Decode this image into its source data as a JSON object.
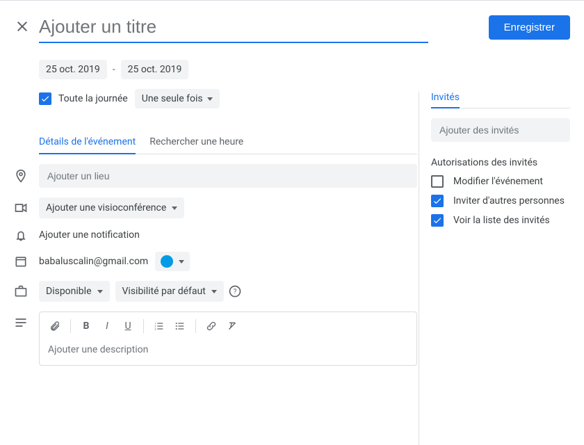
{
  "header": {
    "title_placeholder": "Ajouter un titre",
    "save_label": "Enregistrer"
  },
  "dates": {
    "start": "25 oct. 2019",
    "end": "25 oct. 2019",
    "all_day_label": "Toute la journée",
    "all_day_checked": true,
    "repeat_label": "Une seule fois"
  },
  "tabs": {
    "details": "Détails de l'événement",
    "find_time": "Rechercher une heure"
  },
  "left": {
    "location_placeholder": "Ajouter un lieu",
    "video_label": "Ajouter une visioconférence",
    "notification_label": "Ajouter une notification",
    "owner_email": "babaluscalin@gmail.com",
    "availability_label": "Disponible",
    "visibility_label": "Visibilité par défaut",
    "description_placeholder": "Ajouter une description"
  },
  "right": {
    "guests_tab": "Invités",
    "guests_placeholder": "Ajouter des invités",
    "perms_title": "Autorisations des invités",
    "perms": [
      {
        "label": "Modifier l'événement",
        "checked": false
      },
      {
        "label": "Inviter d'autres personnes",
        "checked": true
      },
      {
        "label": "Voir la liste des invités",
        "checked": true
      }
    ]
  }
}
